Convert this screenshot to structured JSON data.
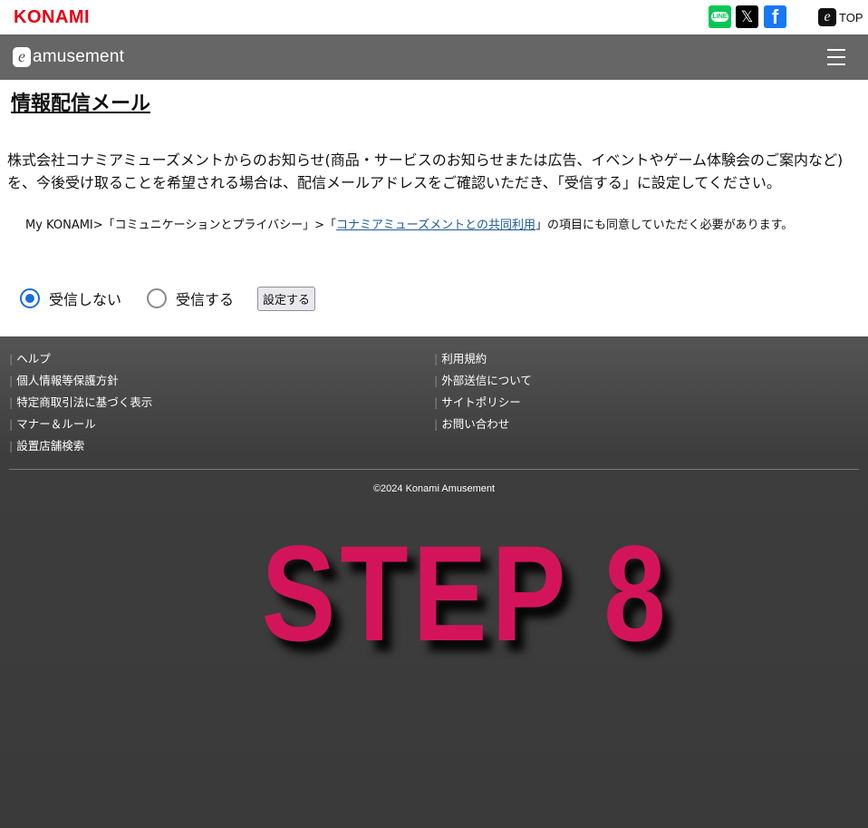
{
  "topbar": {
    "logo": "KONAMI",
    "sns": {
      "line": "LINE",
      "x": "𝕏",
      "facebook": "f"
    },
    "top_link": "TOP"
  },
  "header": {
    "brand": "amusement"
  },
  "main": {
    "title": "情報配信メール",
    "description": "株式会社コナミアミューズメントからのお知らせ(商品・サービスのお知らせまたは広告、イベントやゲーム体験会のご案内など)を、今後受け取ることを希望される場合は、配信メールアドレスをご確認いただき、「受信する」に設定してください。",
    "consent_prefix": "My KONAMI>「コミュニケーションとプライバシー」>「",
    "consent_link": "コナミアミューズメントとの共同利用",
    "consent_suffix": "」の項目にも同意していただく必要があります。",
    "options": [
      {
        "label": "受信しない",
        "checked": true
      },
      {
        "label": "受信する",
        "checked": false
      }
    ],
    "submit_label": "設定する"
  },
  "footer": {
    "left_links": [
      "ヘルプ",
      "個人情報等保護方針",
      "特定商取引法に基づく表示",
      "マナー＆ルール",
      "設置店舗検索"
    ],
    "right_links": [
      "利用規約",
      "外部送信について",
      "サイトポリシー",
      "お問い合わせ"
    ],
    "copyright": "©2024 Konami Amusement"
  },
  "overlay": {
    "step_text": "STEP 8",
    "color": "#d4145a"
  },
  "colors": {
    "brand_red": "#e60012",
    "header_grey": "#666666",
    "radio_blue": "#1a6fd6",
    "link_blue": "#1a5aa0"
  }
}
